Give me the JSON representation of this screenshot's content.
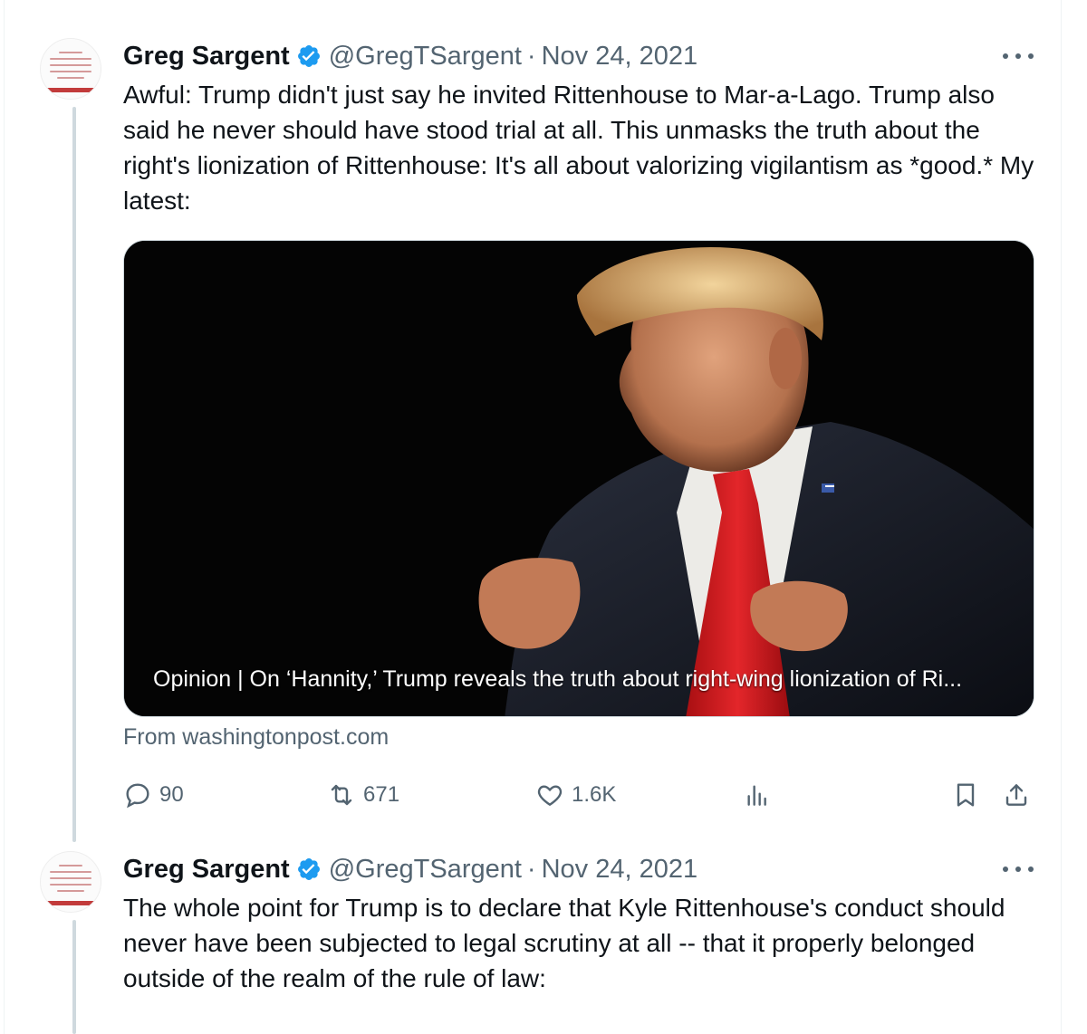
{
  "tweets": [
    {
      "author": {
        "name": "Greg Sargent",
        "handle": "@GregTSargent",
        "verified": true,
        "avatar_text": "TAKING BACK OUR DEMOCRACY IN AN AGE OF TRUMPIAN DISINFORMATION AND THUNDERDOME POLITICS"
      },
      "separator": "·",
      "date": "Nov 24, 2021",
      "text": "Awful: Trump didn't just say he invited Rittenhouse to Mar-a-Lago. Trump also said he never should have stood trial at all. This unmasks the truth about the right's lionization of Rittenhouse: It's all about valorizing vigilantism as *good.* My latest:",
      "card": {
        "title": "Opinion | On ‘Hannity,’ Trump reveals the truth about right-wing lionization of Ri...",
        "source": "From washingtonpost.com"
      },
      "actions": {
        "replies": "90",
        "reposts": "671",
        "likes": "1.6K"
      }
    },
    {
      "author": {
        "name": "Greg Sargent",
        "handle": "@GregTSargent",
        "verified": true
      },
      "separator": "·",
      "date": "Nov 24, 2021",
      "text": "The whole point for Trump is to declare that Kyle Rittenhouse's conduct should never have been subjected to legal scrutiny at all -- that it properly belonged outside of the realm of the rule of law:"
    }
  ],
  "colors": {
    "text": "#0f1419",
    "secondary": "#536471",
    "verified": "#1d9bf0",
    "thread_line": "#cfd9de"
  },
  "icons": {
    "more": "more-dots-icon",
    "verified": "verified-badge-icon",
    "reply": "reply-icon",
    "repost": "repost-icon",
    "like": "heart-icon",
    "views": "views-chart-icon",
    "bookmark": "bookmark-icon",
    "share": "share-icon"
  }
}
